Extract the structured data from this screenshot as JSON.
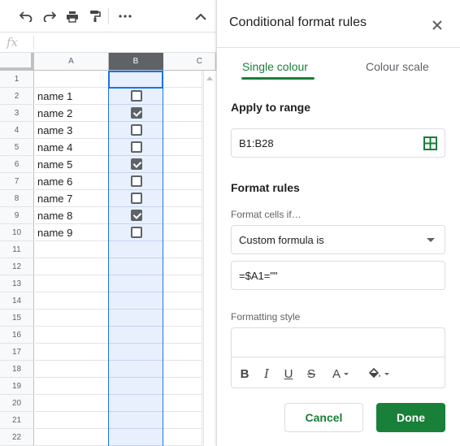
{
  "toolbar": {
    "undo_icon": "undo-icon",
    "redo_icon": "redo-icon",
    "print_icon": "print-icon",
    "paint_format_icon": "paint-format-icon",
    "more_icon": "more-horizontal-icon",
    "collapse_icon": "chevron-up-icon"
  },
  "formula_bar": {
    "fx_label": "fx",
    "value": ""
  },
  "columns": [
    "A",
    "B",
    "C"
  ],
  "rows": [
    {
      "num": "1",
      "name": "",
      "checkbox": null
    },
    {
      "num": "2",
      "name": "name 1",
      "checkbox": false
    },
    {
      "num": "3",
      "name": "name 2",
      "checkbox": true
    },
    {
      "num": "4",
      "name": "name 3",
      "checkbox": false
    },
    {
      "num": "5",
      "name": "name 4",
      "checkbox": false
    },
    {
      "num": "6",
      "name": "name 5",
      "checkbox": true
    },
    {
      "num": "7",
      "name": "name 6",
      "checkbox": false
    },
    {
      "num": "8",
      "name": "name 7",
      "checkbox": false
    },
    {
      "num": "9",
      "name": "name 8",
      "checkbox": true
    },
    {
      "num": "10",
      "name": "name 9",
      "checkbox": false
    },
    {
      "num": "11",
      "name": "",
      "checkbox": null
    },
    {
      "num": "12",
      "name": "",
      "checkbox": null
    },
    {
      "num": "13",
      "name": "",
      "checkbox": null
    },
    {
      "num": "14",
      "name": "",
      "checkbox": null
    },
    {
      "num": "15",
      "name": "",
      "checkbox": null
    },
    {
      "num": "16",
      "name": "",
      "checkbox": null
    },
    {
      "num": "17",
      "name": "",
      "checkbox": null
    },
    {
      "num": "18",
      "name": "",
      "checkbox": null
    },
    {
      "num": "19",
      "name": "",
      "checkbox": null
    },
    {
      "num": "20",
      "name": "",
      "checkbox": null
    },
    {
      "num": "21",
      "name": "",
      "checkbox": null
    },
    {
      "num": "22",
      "name": "",
      "checkbox": null
    }
  ],
  "panel": {
    "title": "Conditional format rules",
    "close_icon": "close-icon",
    "tabs": [
      {
        "label": "Single colour",
        "active": true
      },
      {
        "label": "Colour scale",
        "active": false
      }
    ],
    "apply_to_range": {
      "title": "Apply to range",
      "value": "B1:B28",
      "icon": "grid-icon"
    },
    "format_rules": {
      "title": "Format rules",
      "condition_label": "Format cells if…",
      "condition_value": "Custom formula is",
      "formula_value": "=$A1=\"\""
    },
    "formatting_style": {
      "label": "Formatting style",
      "buttons": [
        "B",
        "I",
        "U",
        "S",
        "A"
      ]
    },
    "cancel_label": "Cancel",
    "done_label": "Done"
  },
  "colors": {
    "accent_green": "#188038",
    "selection_blue": "#1a73e8",
    "selection_fill": "#e8f0fe"
  }
}
